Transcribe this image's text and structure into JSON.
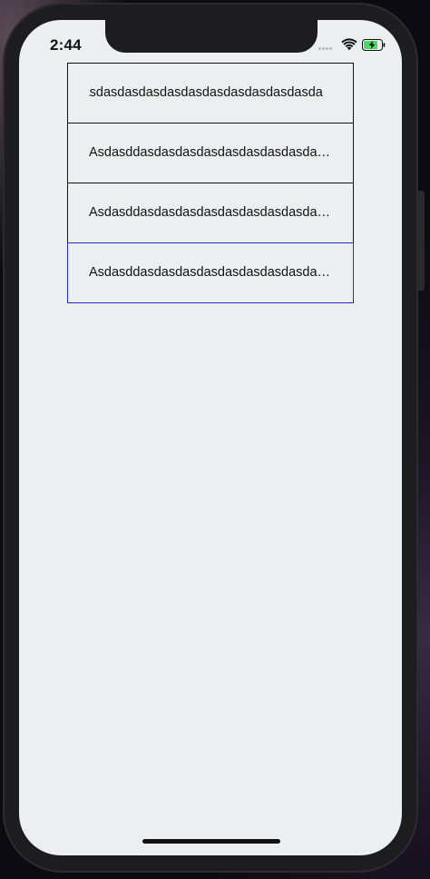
{
  "status_bar": {
    "time": "2:44"
  },
  "list": {
    "rows": [
      {
        "text": "Asdasdasdasdasdasdasdasdasdasdasda",
        "state": "scrolled-marquee"
      },
      {
        "text": "Asdasddasdasdasdasdasdasdasdasdasdasda",
        "state": "truncated"
      },
      {
        "text": "Asdasddasdasdasdasdasdasdasdasdasdasda",
        "state": "truncated"
      },
      {
        "text": "Asdasddasdasdasdasdasdasdasdasdasdasda",
        "state": "selected"
      }
    ]
  },
  "colors": {
    "screen_background": "#ebeff0",
    "row_border": "#111111",
    "selected_border": "#2330c7",
    "battery_fill": "#4cd964"
  },
  "icons": [
    "wifi-icon",
    "battery-charging-icon",
    "signal-dots-icon"
  ]
}
